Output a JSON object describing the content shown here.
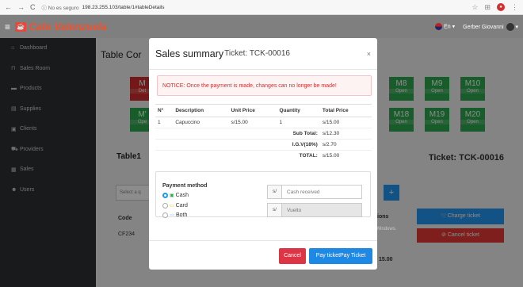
{
  "browser": {
    "security": "ⓘ No es seguro",
    "address": "198.23.255.103/table/1#tableDetails"
  },
  "navbar": {
    "brand": "Cafe Valenzuela",
    "language": "En ▾",
    "user": "Gerber Giovanni"
  },
  "sidebar": {
    "items": [
      {
        "label": "Dashboard"
      },
      {
        "label": "Sales Room"
      },
      {
        "label": "Products"
      },
      {
        "label": "Supplies"
      },
      {
        "label": "Clients"
      },
      {
        "label": "Providers"
      },
      {
        "label": "Sales"
      },
      {
        "label": "Users"
      }
    ]
  },
  "background": {
    "title": "Table Cor",
    "tiles": [
      {
        "num": "M",
        "status": "Det",
        "color": "red"
      },
      {
        "num": "M'",
        "status": "Ope",
        "color": "green"
      },
      {
        "num": "M8",
        "status": "Open",
        "color": "green"
      },
      {
        "num": "M9",
        "status": "Open",
        "color": "green"
      },
      {
        "num": "M10",
        "status": "Open",
        "color": "green"
      },
      {
        "num": "M18",
        "status": "Open",
        "color": "green"
      },
      {
        "num": "M19",
        "status": "Open",
        "color": "green"
      },
      {
        "num": "M20",
        "status": "Open",
        "color": "green"
      }
    ],
    "table1": "Table1",
    "ticket": "Ticket: TCK-00016",
    "select_placeholder": "Select a q",
    "code_header": "Code",
    "code_value": "CF234",
    "options_header": "ions",
    "charge_button": "Charge ticket",
    "cancel_button": "Cancel ticket",
    "total_fragment": "15.00",
    "watermark_line1": "Activar Windows",
    "watermark_line2": "Ve a Configuración para activar Windows."
  },
  "modal": {
    "title": "Sales summary",
    "ticket": "Ticket: TCK-00016",
    "close": "×",
    "notice": "NOTICE: Once the payment is made, changes can no longer be made!",
    "columns": [
      "N°",
      "Description",
      "Unit Price",
      "Quantity",
      "Total Price"
    ],
    "rows": [
      {
        "n": "1",
        "description": "Capuccino",
        "unit_price": "s/15.00",
        "quantity": "1",
        "total": "s/15.00"
      }
    ],
    "summary": [
      {
        "label": "Sub Total:",
        "value": "s/12.30"
      },
      {
        "label": "I.G.V(18%)",
        "value": "s/2.70"
      },
      {
        "label": "TOTAL:",
        "value": "s/15.00"
      }
    ],
    "payment": {
      "title": "Payment method",
      "options": [
        {
          "label": "Cash",
          "selected": true
        },
        {
          "label": "Card",
          "selected": false
        },
        {
          "label": "Both",
          "selected": false
        }
      ],
      "currency": "s/",
      "cash_placeholder": "Cash received",
      "change_placeholder": "Vuelto"
    },
    "cancel_button": "Cancel",
    "pay_button": "Pay ticketPay Ticket"
  }
}
